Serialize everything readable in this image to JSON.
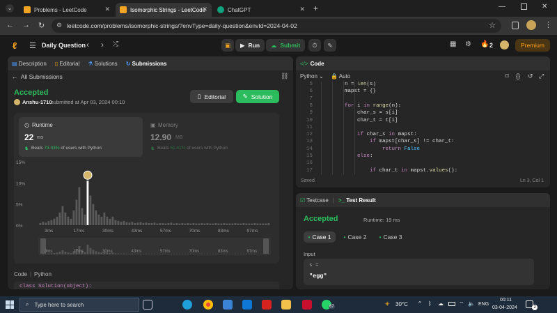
{
  "browser": {
    "tabs": [
      {
        "title": "Problems - LeetCode",
        "active": false
      },
      {
        "title": "Isomorphic Strings - LeetCode",
        "active": true
      },
      {
        "title": "ChatGPT",
        "active": false
      }
    ],
    "url": "leetcode.com/problems/isomorphic-strings/?envType=daily-question&envId=2024-04-02"
  },
  "header": {
    "title": "Daily Question",
    "run": "Run",
    "submit": "Submit",
    "streak": "2",
    "premium": "Premium"
  },
  "left": {
    "tabs": [
      "Description",
      "Editorial",
      "Solutions",
      "Submissions"
    ],
    "back": "All Submissions",
    "status": "Accepted",
    "user": "Anshu-1710",
    "submitted": "submitted at Apr 03, 2024 00:10",
    "editorial_btn": "Editorial",
    "solution_btn": "Solution",
    "runtime": {
      "label": "Runtime",
      "value": "22",
      "unit": "ms",
      "beats_pre": "Beats",
      "beats": "73.03%",
      "beats_post": "of users with Python"
    },
    "memory": {
      "label": "Memory",
      "value": "12.90",
      "unit": "MB",
      "beats_pre": "Beats",
      "beats": "51.41%",
      "beats_post": "of users with Python"
    },
    "code_label": "Code",
    "lang": "Python",
    "code_preview": "class Solution(object):"
  },
  "chart_data": {
    "type": "bar",
    "ylabels": [
      "15%",
      "10%",
      "5%",
      "0%"
    ],
    "ylim": [
      0,
      15
    ],
    "xlabels": [
      "3ms",
      "17ms",
      "30ms",
      "43ms",
      "57ms",
      "70ms",
      "83ms",
      "97ms"
    ],
    "mini_xlabels": [
      "3ms",
      "17ms",
      "30ms",
      "43ms",
      "57ms",
      "70ms",
      "83ms",
      "97ms"
    ],
    "highlight_index": 17,
    "values": [
      0.5,
      0.8,
      0.6,
      1,
      1.2,
      1.5,
      2,
      3,
      4.5,
      3,
      2,
      1.5,
      3.5,
      6,
      9,
      4,
      2.5,
      10.5,
      7,
      5,
      3.5,
      2.5,
      2,
      3,
      2,
      1.5,
      2,
      1.2,
      1,
      0.8,
      1,
      0.7,
      0.6,
      0.8,
      0.5,
      0.6,
      0.7,
      0.5,
      0.6,
      0.5,
      0.5,
      0.6,
      0.4,
      0.5,
      0.5,
      0.4,
      0.5,
      0.6,
      0.4,
      0.5,
      0.4,
      0.5,
      0.4,
      0.5,
      0.4,
      0.5,
      0.4,
      0.4,
      0.5,
      0.4,
      0.5,
      0.4,
      0.4,
      0.5,
      0.4,
      0.4,
      0.5,
      0.4,
      0.4,
      0.4,
      0.5,
      0.4,
      0.4,
      0.5,
      0.4,
      0.4,
      0.4,
      0.5,
      0.4,
      0.4,
      0.4,
      0.4,
      0.5
    ]
  },
  "editor": {
    "title": "Code",
    "lang": "Python",
    "mode": "Auto",
    "saved": "Saved",
    "position": "Ln 3, Col 1",
    "lines": [
      {
        "n": "5",
        "t": "        n = len(s)"
      },
      {
        "n": "6",
        "t": "        mapst = {}"
      },
      {
        "n": "7",
        "t": ""
      },
      {
        "n": "8",
        "t": "        for i in range(n):"
      },
      {
        "n": "9",
        "t": "            char_s = s[i]"
      },
      {
        "n": "10",
        "t": "            char_t = t[i]"
      },
      {
        "n": "11",
        "t": ""
      },
      {
        "n": "12",
        "t": "            if char_s in mapst:"
      },
      {
        "n": "13",
        "t": "                if mapst[char_s] != char_t:"
      },
      {
        "n": "14",
        "t": "                    return False"
      },
      {
        "n": "15",
        "t": "            else:"
      },
      {
        "n": "16",
        "t": ""
      },
      {
        "n": "17",
        "t": "                if char_t in mapst.values():"
      }
    ]
  },
  "result": {
    "tab1": "Testcase",
    "tab2": "Test Result",
    "status": "Accepted",
    "runtime": "Runtime: 19 ms",
    "cases": [
      "Case 1",
      "Case 2",
      "Case 3"
    ],
    "input_label": "Input",
    "var": "s =",
    "value": "\"egg\""
  },
  "taskbar": {
    "search": "Type here to search",
    "badge": "67",
    "temp": "30°C",
    "lang": "ENG",
    "time": "00:11",
    "date": "03-04-2024",
    "notif": "2"
  }
}
